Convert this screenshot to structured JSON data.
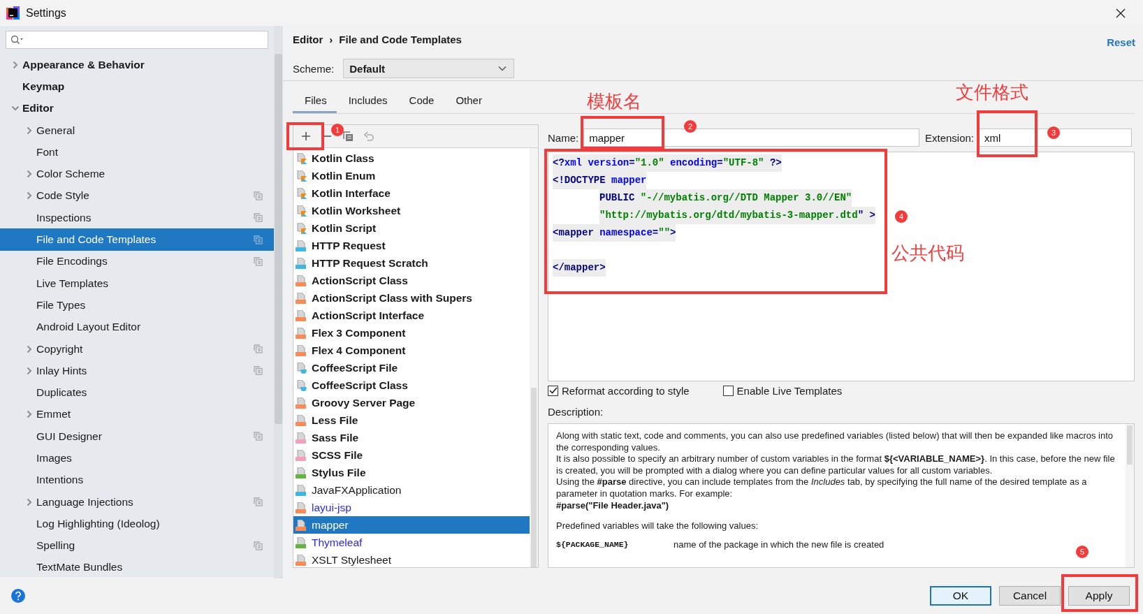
{
  "window": {
    "title": "Settings"
  },
  "sidebar": {
    "items": [
      {
        "label": "Appearance & Behavior",
        "expanded": false,
        "selected": false
      },
      {
        "label": "Keymap",
        "selected": false
      },
      {
        "label": "Editor",
        "expanded": true,
        "selected": false,
        "children": [
          {
            "label": "General",
            "expanded": false,
            "project": false,
            "selected": false
          },
          {
            "label": "Font",
            "project": false,
            "selected": false
          },
          {
            "label": "Color Scheme",
            "expanded": false,
            "project": false,
            "selected": false
          },
          {
            "label": "Code Style",
            "expanded": false,
            "project": true,
            "selected": false
          },
          {
            "label": "Inspections",
            "project": true,
            "selected": false
          },
          {
            "label": "File and Code Templates",
            "project": true,
            "selected": true
          },
          {
            "label": "File Encodings",
            "project": true,
            "selected": false
          },
          {
            "label": "Live Templates",
            "project": false,
            "selected": false
          },
          {
            "label": "File Types",
            "project": false,
            "selected": false
          },
          {
            "label": "Android Layout Editor",
            "project": false,
            "selected": false
          },
          {
            "label": "Copyright",
            "expanded": false,
            "project": true,
            "selected": false
          },
          {
            "label": "Inlay Hints",
            "expanded": false,
            "project": true,
            "selected": false
          },
          {
            "label": "Duplicates",
            "project": false,
            "selected": false
          },
          {
            "label": "Emmet",
            "expanded": false,
            "project": false,
            "selected": false
          },
          {
            "label": "GUI Designer",
            "project": true,
            "selected": false
          },
          {
            "label": "Images",
            "project": false,
            "selected": false
          },
          {
            "label": "Intentions",
            "project": false,
            "selected": false
          },
          {
            "label": "Language Injections",
            "expanded": false,
            "project": true,
            "selected": false
          },
          {
            "label": "Log Highlighting (Ideolog)",
            "project": false,
            "selected": false
          },
          {
            "label": "Spelling",
            "project": true,
            "selected": false
          },
          {
            "label": "TextMate Bundles",
            "project": false,
            "selected": false
          }
        ]
      }
    ]
  },
  "breadcrumb": {
    "items": [
      "Editor",
      "File and Code Templates"
    ],
    "separator": "›"
  },
  "reset_link": "Reset",
  "scheme": {
    "label": "Scheme:",
    "value": "Default"
  },
  "tabs": [
    {
      "label": "Files",
      "selected": true
    },
    {
      "label": "Includes",
      "selected": false
    },
    {
      "label": "Code",
      "selected": false
    },
    {
      "label": "Other",
      "selected": false
    }
  ],
  "templates": [
    {
      "name": "Kotlin Class",
      "kind": "kotlin",
      "bold": true,
      "custom": false,
      "selected": false
    },
    {
      "name": "Kotlin Enum",
      "kind": "kotlin",
      "bold": true,
      "custom": false,
      "selected": false
    },
    {
      "name": "Kotlin Interface",
      "kind": "kotlin",
      "bold": true,
      "custom": false,
      "selected": false
    },
    {
      "name": "Kotlin Worksheet",
      "kind": "kotlin",
      "bold": true,
      "custom": false,
      "selected": false
    },
    {
      "name": "Kotlin Script",
      "kind": "kotlin",
      "bold": true,
      "custom": false,
      "selected": false
    },
    {
      "name": "HTTP Request",
      "kind": "api",
      "bold": true,
      "custom": false,
      "selected": false
    },
    {
      "name": "HTTP Request Scratch",
      "kind": "api",
      "bold": true,
      "custom": false,
      "selected": false
    },
    {
      "name": "ActionScript Class",
      "kind": "actionscript",
      "bold": true,
      "custom": false,
      "selected": false
    },
    {
      "name": "ActionScript Class with Supers",
      "kind": "actionscript",
      "bold": true,
      "custom": false,
      "selected": false
    },
    {
      "name": "ActionScript Interface",
      "kind": "actionscript",
      "bold": true,
      "custom": false,
      "selected": false
    },
    {
      "name": "Flex 3 Component",
      "kind": "markup",
      "bold": true,
      "custom": false,
      "selected": false
    },
    {
      "name": "Flex 4 Component",
      "kind": "markup",
      "bold": true,
      "custom": false,
      "selected": false
    },
    {
      "name": "CoffeeScript File",
      "kind": "coffee",
      "bold": true,
      "custom": false,
      "selected": false
    },
    {
      "name": "CoffeeScript Class",
      "kind": "coffee",
      "bold": true,
      "custom": false,
      "selected": false
    },
    {
      "name": "Groovy Server Page",
      "kind": "gsp",
      "bold": true,
      "custom": false,
      "selected": false
    },
    {
      "name": "Less File",
      "kind": "less",
      "bold": true,
      "custom": false,
      "selected": false
    },
    {
      "name": "Sass File",
      "kind": "sass",
      "bold": true,
      "custom": false,
      "selected": false
    },
    {
      "name": "SCSS File",
      "kind": "sass",
      "bold": true,
      "custom": false,
      "selected": false
    },
    {
      "name": "Stylus File",
      "kind": "stylus",
      "bold": true,
      "custom": false,
      "selected": false
    },
    {
      "name": "JavaFXApplication",
      "kind": "java",
      "bold": false,
      "custom": false,
      "selected": false
    },
    {
      "name": "layui-jsp",
      "kind": "jsp",
      "bold": false,
      "custom": true,
      "selected": false
    },
    {
      "name": "mapper",
      "kind": "markup",
      "bold": false,
      "custom": false,
      "selected": true
    },
    {
      "name": "Thymeleaf",
      "kind": "html",
      "bold": false,
      "custom": true,
      "selected": false
    },
    {
      "name": "XSLT Stylesheet",
      "kind": "markup",
      "bold": false,
      "custom": false,
      "selected": false
    }
  ],
  "form": {
    "name_label": "Name:",
    "name": "mapper",
    "extension_label": "Extension:",
    "extension": "xml",
    "code": [
      {
        "space_before": false,
        "indented": false,
        "tokens": [
          {
            "kind": "punct",
            "text": "<?"
          },
          {
            "kind": "name",
            "text": "xml version="
          },
          {
            "kind": "string",
            "text": "\"1.0\""
          },
          {
            "kind": "name",
            "text": " encoding="
          },
          {
            "kind": "string",
            "text": "\"UTF-8\""
          },
          {
            "kind": "punct",
            "text": " ?>"
          }
        ]
      },
      {
        "space_before": false,
        "indented": false,
        "tokens": [
          {
            "kind": "punct",
            "text": "<!DOCTYPE"
          },
          {
            "kind": "name",
            "text": " mapper"
          }
        ]
      },
      {
        "space_before": false,
        "indented": true,
        "tokens": [
          {
            "kind": "punct",
            "text": "PUBLIC"
          },
          {
            "kind": "string",
            "text": " \"-//mybatis.org//DTD Mapper 3.0//EN\""
          }
        ]
      },
      {
        "space_before": false,
        "indented": true,
        "tokens": [
          {
            "kind": "string",
            "text": "\"http://mybatis.org/dtd/mybatis-3-mapper.dtd"
          },
          {
            "kind": "punct",
            "text": "\" >"
          }
        ]
      },
      {
        "space_before": false,
        "indented": false,
        "tokens": [
          {
            "kind": "punct",
            "text": "<mapper"
          },
          {
            "kind": "name",
            "text": " namespace="
          },
          {
            "kind": "string",
            "text": "\"\""
          },
          {
            "kind": "punct",
            "text": ">"
          }
        ]
      },
      {
        "space_before": true,
        "indented": false,
        "tokens": [
          {
            "kind": "punct",
            "text": "</mapper>"
          }
        ]
      }
    ],
    "options": [
      {
        "label": "Reformat according to style",
        "checked": true
      },
      {
        "label": "Enable Live Templates",
        "checked": false
      }
    ]
  },
  "description": {
    "label": "Description:",
    "paragraphs": [
      "Along with static text, code and comments, you can also use predefined variables (listed below) that will then be expanded like macros into the corresponding values.",
      "It is also possible to specify an arbitrary number of custom variables in the format **${<VARIABLE_NAME>}**. In this case, before the new file is created, you will be prompted with a dialog where you can define particular values for all custom variables.",
      "Using the **#parse** directive, you can include templates from the *Includes* tab, by specifying the full name of the desired template as a parameter in quotation marks. For example:"
    ],
    "example": "#parse(\"File Header.java\")",
    "variables_intro": "Predefined variables will take the following values:",
    "variables": [
      {
        "name": "${PACKAGE_NAME}",
        "meaning": "name of the package in which the new file is created"
      }
    ]
  },
  "buttons": [
    {
      "label": "OK",
      "kind": "default"
    },
    {
      "label": "Cancel",
      "kind": "normal"
    },
    {
      "label": "Apply",
      "kind": "normal"
    }
  ],
  "annotations": [
    {
      "number": "1"
    },
    {
      "number": "2",
      "label": "模板名"
    },
    {
      "number": "3",
      "label": "文件格式"
    },
    {
      "number": "4",
      "label": "公共代码"
    },
    {
      "number": "5"
    }
  ]
}
